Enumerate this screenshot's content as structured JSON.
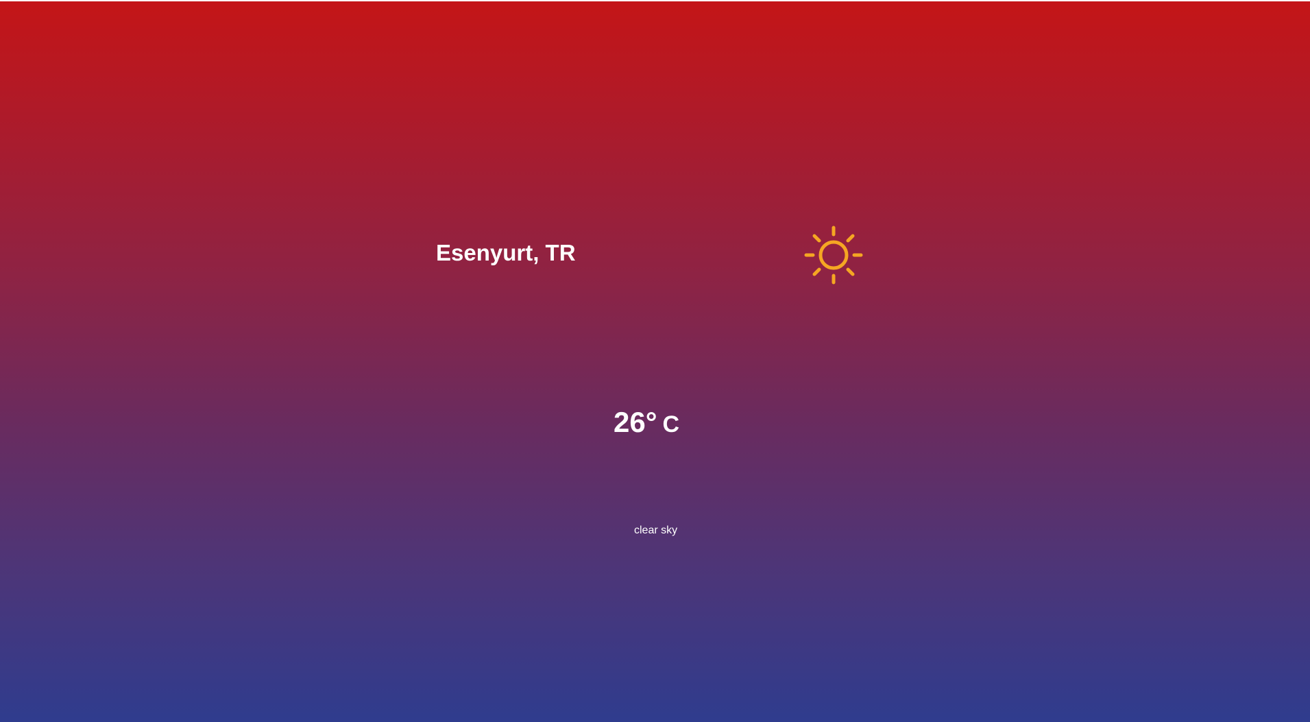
{
  "location": {
    "city": "Esenyurt, TR"
  },
  "weather": {
    "temperature": "26°",
    "unit": "C",
    "description": "clear sky",
    "icon": "sun-icon"
  },
  "colors": {
    "gradient_top": "#c41517",
    "gradient_bottom": "#2f3c8e",
    "sun": "#f5a623",
    "text": "#ffffff"
  }
}
